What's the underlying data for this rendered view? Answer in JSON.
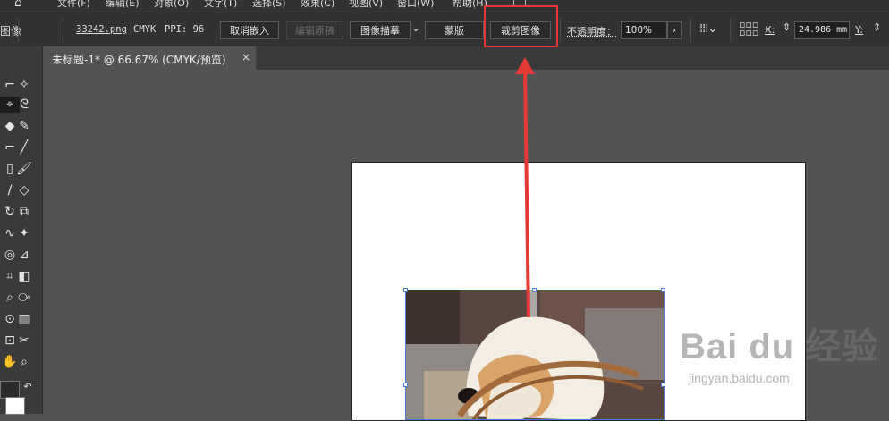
{
  "menu": {
    "items": [
      "文件(F)",
      "编辑(E)",
      "对象(O)",
      "文字(T)",
      "选择(S)",
      "效果(C)",
      "视图(V)",
      "窗口(W)",
      "帮助(H)"
    ]
  },
  "control_bar": {
    "section_label": "图像",
    "filename": "33242.png",
    "color_mode": "CMYK",
    "ppi": "PPI: 96",
    "buttons": {
      "unembed": "取消嵌入",
      "edit_original": "编辑原稿",
      "image_trace": "图像描摹",
      "mask": "蒙版",
      "crop_image": "裁剪图像"
    },
    "opacity_label": "不透明度：",
    "opacity_value": "100%",
    "x_label": "X:",
    "x_value": "24.986 mm",
    "y_label": "Y:"
  },
  "document_tab": {
    "title": "未标题-1* @ 66.67% (CMYK/预览)",
    "close": "×"
  },
  "watermark": {
    "brand": "Bai du 经验",
    "url": "jingyan.baidu.com"
  },
  "colors": {
    "annotation": "#e53935",
    "selection": "#4c7bd8",
    "workspace": "#535353",
    "panel": "#323232"
  }
}
